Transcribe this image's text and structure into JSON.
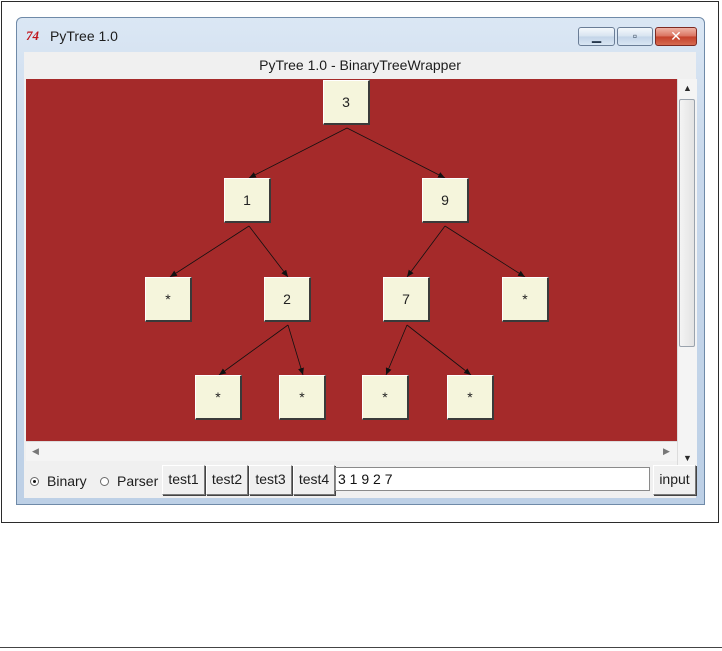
{
  "window": {
    "title": "PyTree 1.0",
    "app_icon_glyph": "74",
    "min_glyph": "▁",
    "max_glyph": "▫",
    "close_glyph": "✕"
  },
  "header": {
    "title": "PyTree 1.0 - BinaryTreeWrapper"
  },
  "tree": {
    "nodes": [
      "3",
      "1",
      "9",
      "*",
      "2",
      "7",
      "*",
      "*",
      "*",
      "*",
      "*"
    ],
    "colors": {
      "canvas": "#a52a2a",
      "node_fill": "#f5f5dc"
    }
  },
  "controls": {
    "radio_binary": "Binary",
    "radio_parser": "Parser",
    "selected_mode": "Binary",
    "buttons": [
      "test1",
      "test2",
      "test3",
      "test4"
    ],
    "input_value": "3 1 9 2 7",
    "input_button": "input"
  }
}
